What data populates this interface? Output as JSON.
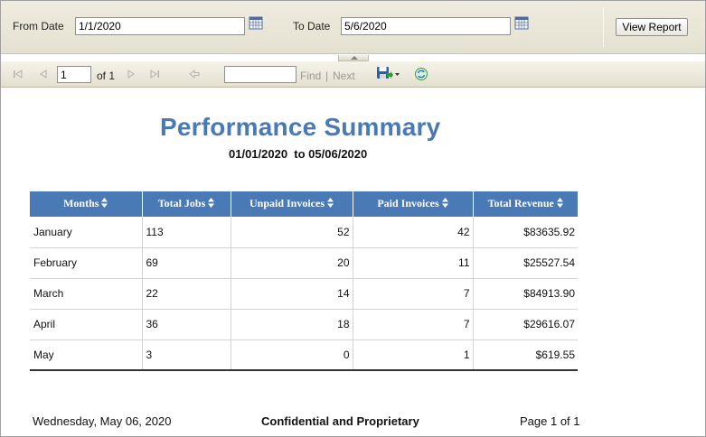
{
  "params": {
    "from_label": "From Date",
    "from_value": "1/1/2020",
    "to_label": "To Date",
    "to_value": "5/6/2020",
    "view_report_label": "View Report"
  },
  "toolbar": {
    "page_value": "1",
    "of_label": "of 1",
    "find_value": "",
    "find_label": "Find",
    "separator": "|",
    "next_label": "Next"
  },
  "report": {
    "title": "Performance Summary",
    "date_range": "01/01/2020  to 05/06/2020",
    "columns": [
      "Months",
      "Total Jobs",
      "Unpaid Invoices",
      "Paid Invoices",
      "Total Revenue"
    ],
    "rows": [
      {
        "month": "January",
        "total_jobs": "113",
        "unpaid": "52",
        "paid": "42",
        "revenue": "$83635.92"
      },
      {
        "month": "February",
        "total_jobs": "69",
        "unpaid": "20",
        "paid": "11",
        "revenue": "$25527.54"
      },
      {
        "month": "March",
        "total_jobs": "22",
        "unpaid": "14",
        "paid": "7",
        "revenue": "$84913.90"
      },
      {
        "month": "April",
        "total_jobs": "36",
        "unpaid": "18",
        "paid": "7",
        "revenue": "$29616.07"
      },
      {
        "month": "May",
        "total_jobs": "3",
        "unpaid": "0",
        "paid": "1",
        "revenue": "$619.55"
      }
    ],
    "footer_date": "Wednesday, May 06, 2020",
    "footer_confidential": "Confidential and Proprietary",
    "footer_page": "Page 1 of 1"
  },
  "colors": {
    "header_bg": "#4a7ab5",
    "title_color": "#4a7ab5",
    "toolbar_bg": "#ece9d8"
  },
  "icons": {
    "calendar": "calendar-icon",
    "first_page": "first-page-icon",
    "prev_page": "previous-page-icon",
    "next_page": "next-page-icon",
    "last_page": "last-page-icon",
    "back": "back-to-parent-icon",
    "export": "save-export-icon",
    "refresh": "refresh-icon",
    "sort": "sort-icon"
  }
}
